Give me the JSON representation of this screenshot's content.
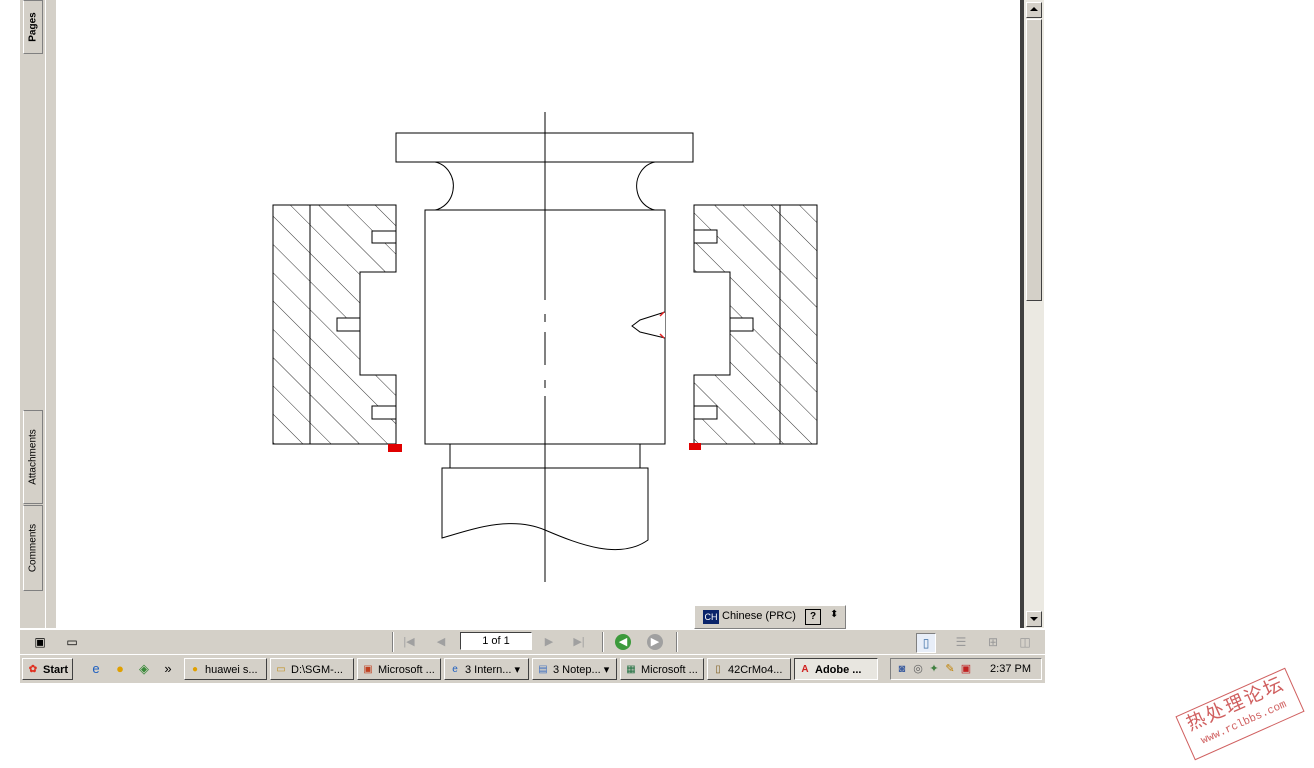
{
  "nav_tabs": {
    "pages": "Pages",
    "attachments": "Attachments",
    "comments": "Comments"
  },
  "language_bar": {
    "code": "CH",
    "name": "Chinese (PRC)",
    "help": "?",
    "options": "⬍"
  },
  "page_nav": {
    "page_field": "1 of 1"
  },
  "taskbar": {
    "start": "Start",
    "quick_launch_more": "»",
    "buttons": [
      {
        "label": "huawei s...",
        "icon": "app-icon"
      },
      {
        "label": "D:\\SGM-...",
        "icon": "folder-icon"
      },
      {
        "label": "Microsoft ...",
        "icon": "powerpoint-icon"
      },
      {
        "label": "3 Intern...",
        "icon": "ie-icon"
      },
      {
        "label": "3 Notep...",
        "icon": "notepad-icon"
      },
      {
        "label": "Microsoft ...",
        "icon": "excel-icon"
      },
      {
        "label": "42CrMo4...",
        "icon": "document-icon"
      },
      {
        "label": "Adobe ...",
        "icon": "acrobat-icon"
      }
    ],
    "clock": "2:37 PM"
  },
  "watermark": {
    "chinese": "热处理论坛",
    "url": "www.rclbbs.com"
  }
}
